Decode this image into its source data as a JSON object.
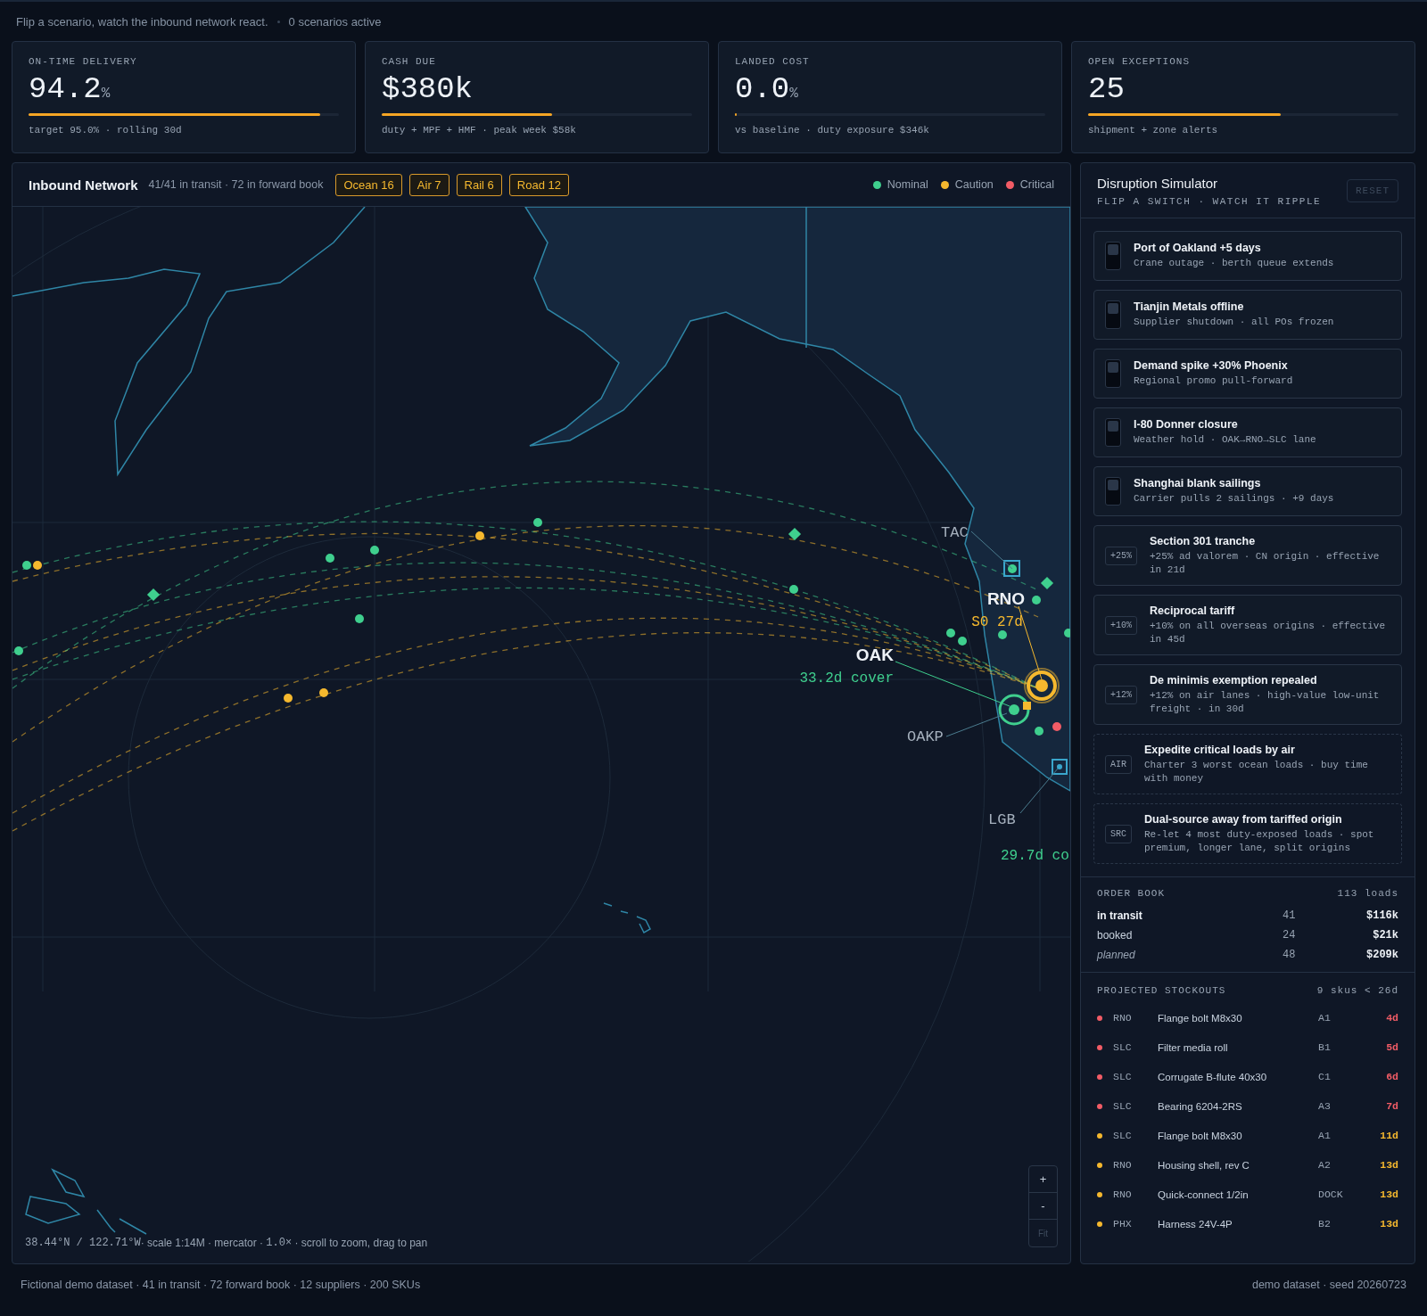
{
  "header": {
    "tagline": "Flip a scenario, watch the inbound network react.",
    "active": "0 scenarios active"
  },
  "kpis": [
    {
      "label": "ON-TIME DELIVERY",
      "value": "94.2",
      "unit": "%",
      "level": 0.94,
      "note": "target 95.0% · rolling 30d"
    },
    {
      "label": "CASH DUE",
      "value": "$380k",
      "level": 0.55,
      "note": "duty + MPF + HMF · peak week $58k"
    },
    {
      "label": "LANDED COST",
      "value": "0.0",
      "unit": "%",
      "level": 0,
      "note": "vs baseline · duty exposure $346k"
    },
    {
      "label": "OPEN EXCEPTIONS",
      "value": "25",
      "level": 0.62,
      "note": "shipment + zone alerts"
    }
  ],
  "map": {
    "title": "Inbound Network",
    "summary": "41/41 in transit · 72 in forward book",
    "modes": [
      {
        "label": "Ocean 16"
      },
      {
        "label": "Air 7"
      },
      {
        "label": "Rail 6"
      },
      {
        "label": "Road 12"
      }
    ],
    "legend": [
      {
        "label": "Nominal",
        "color": "#3fcf8e"
      },
      {
        "label": "Caution",
        "color": "#f5b82e"
      },
      {
        "label": "Critical",
        "color": "#f25c66"
      }
    ],
    "sites": [
      {
        "code": "TAC"
      },
      {
        "code": "RNO",
        "note": "S0 27d",
        "color": "#f5b82e"
      },
      {
        "code": "OAK",
        "note": "33.2d cover",
        "color": "#3fcf8e"
      },
      {
        "code": "OAKP"
      },
      {
        "code": "LGB"
      },
      {
        "note": "29.7d co",
        "color": "#3fcf8e"
      }
    ],
    "coords": "38.44°N / 122.71°W",
    "scale": "· scale 1:14M · mercator · ",
    "zoom": "1.0×",
    "hint": " · scroll to zoom, drag to pan",
    "controls": [
      {
        "label": "+",
        "disabled": false
      },
      {
        "label": "-",
        "disabled": false
      },
      {
        "label": "Fit",
        "disabled": true
      }
    ]
  },
  "simulator": {
    "title": "Disruption Simulator",
    "subtitle": "FLIP A SWITCH · WATCH IT RIPPLE",
    "reset": {
      "label": "RESET",
      "disabled": true
    },
    "scenarios": [
      {
        "kind": "toggle",
        "on": false,
        "title": "Port of Oakland +5 days",
        "detail": "Crane outage · berth queue extends"
      },
      {
        "kind": "toggle",
        "on": false,
        "title": "Tianjin Metals offline",
        "detail": "Supplier shutdown · all POs frozen"
      },
      {
        "kind": "toggle",
        "on": false,
        "title": "Demand spike +30% Phoenix",
        "detail": "Regional promo pull-forward"
      },
      {
        "kind": "toggle",
        "on": false,
        "title": "I-80 Donner closure",
        "detail": "Weather hold · OAK→RNO→SLC lane"
      },
      {
        "kind": "toggle",
        "on": false,
        "title": "Shanghai blank sailings",
        "detail": "Carrier pulls 2 sailings · +9 days"
      },
      {
        "kind": "tariff",
        "badge": "+25%",
        "title": "Section 301 tranche",
        "detail": "+25% ad valorem · CN origin · effective in 21d"
      },
      {
        "kind": "tariff",
        "badge": "+10%",
        "title": "Reciprocal tariff",
        "detail": "+10% on all overseas origins · effective in 45d"
      },
      {
        "kind": "tariff",
        "badge": "+12%",
        "title": "De minimis exemption repealed",
        "detail": "+12% on air lanes · high-value low-unit freight · in 30d"
      },
      {
        "kind": "action",
        "badge": "AIR",
        "title": "Expedite critical loads by air",
        "detail": "Charter 3 worst ocean loads · buy time with money"
      },
      {
        "kind": "action",
        "badge": "SRC",
        "title": "Dual-source away from tariffed origin",
        "detail": "Re-let 4 most duty-exposed loads · spot premium, longer lane, split origins"
      }
    ]
  },
  "order_book": {
    "title": "ORDER BOOK",
    "total": "113 loads",
    "rows": [
      {
        "kind": "strong",
        "label": "in transit",
        "count": "41",
        "value": "$116k"
      },
      {
        "kind": "plain",
        "label": "booked",
        "count": "24",
        "value": "$21k"
      },
      {
        "kind": "muted",
        "label": "planned",
        "count": "48",
        "value": "$209k"
      }
    ]
  },
  "stockouts": {
    "title": "PROJECTED STOCKOUTS",
    "summary": "9 skus < 26d",
    "rows": [
      {
        "color": "#f25c66",
        "site": "RNO",
        "item": "Flange bolt M8x30",
        "slot": "A1",
        "days": "4d"
      },
      {
        "color": "#f25c66",
        "site": "SLC",
        "item": "Filter media roll",
        "slot": "B1",
        "days": "5d"
      },
      {
        "color": "#f25c66",
        "site": "SLC",
        "item": "Corrugate B-flute 40x30",
        "slot": "C1",
        "days": "6d"
      },
      {
        "color": "#f25c66",
        "site": "SLC",
        "item": "Bearing 6204-2RS",
        "slot": "A3",
        "days": "7d"
      },
      {
        "color": "#f5b82e",
        "site": "SLC",
        "item": "Flange bolt M8x30",
        "slot": "A1",
        "days": "11d"
      },
      {
        "color": "#f5b82e",
        "site": "RNO",
        "item": "Housing shell, rev C",
        "slot": "A2",
        "days": "13d"
      },
      {
        "color": "#f5b82e",
        "site": "RNO",
        "item": "Quick-connect 1/2in",
        "slot": "DOCK",
        "days": "13d"
      },
      {
        "color": "#f5b82e",
        "site": "PHX",
        "item": "Harness 24V-4P",
        "slot": "B2",
        "days": "13d"
      }
    ]
  },
  "footer": {
    "left": "Fictional demo dataset · 41 in transit · 72 forward book · 12 suppliers · 200 SKUs",
    "right": "demo dataset · seed 20260723"
  }
}
